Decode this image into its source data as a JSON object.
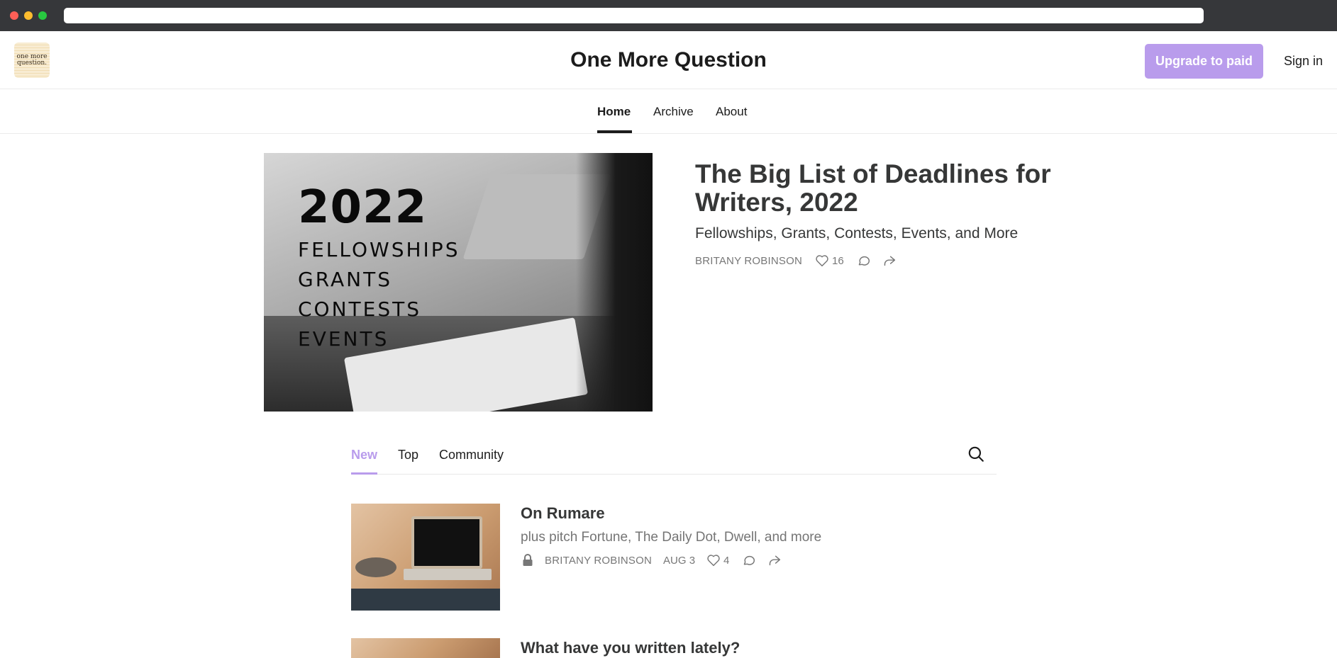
{
  "header": {
    "logo_line1": "one more",
    "logo_line2": "question.",
    "title": "One More Question",
    "upgrade_label": "Upgrade to paid",
    "signin_label": "Sign in"
  },
  "nav": {
    "items": [
      {
        "label": "Home",
        "active": true
      },
      {
        "label": "Archive",
        "active": false
      },
      {
        "label": "About",
        "active": false
      }
    ]
  },
  "hero": {
    "image": {
      "year": "2022",
      "words": [
        "FELLOWSHIPS",
        "GRANTS",
        "CONTESTS",
        "EVENTS"
      ]
    },
    "title": "The Big List of Deadlines for Writers, 2022",
    "subtitle": "Fellowships, Grants, Contests, Events, and More",
    "author": "BRITANY ROBINSON",
    "likes": "16"
  },
  "tabs": {
    "items": [
      {
        "label": "New",
        "active": true
      },
      {
        "label": "Top",
        "active": false
      },
      {
        "label": "Community",
        "active": false
      }
    ]
  },
  "posts": [
    {
      "title": "On Rumare",
      "subtitle": "plus pitch Fortune, The Daily Dot, Dwell, and more",
      "author": "BRITANY ROBINSON",
      "date": "AUG 3",
      "likes": "4",
      "locked": true
    },
    {
      "title": "What have you written lately?"
    }
  ],
  "colors": {
    "accent": "#b99cec",
    "text": "#1c1c1c",
    "heading": "#363737",
    "meta": "#777777"
  },
  "icons": [
    "heart-icon",
    "comment-icon",
    "share-icon",
    "search-icon",
    "lock-icon"
  ]
}
